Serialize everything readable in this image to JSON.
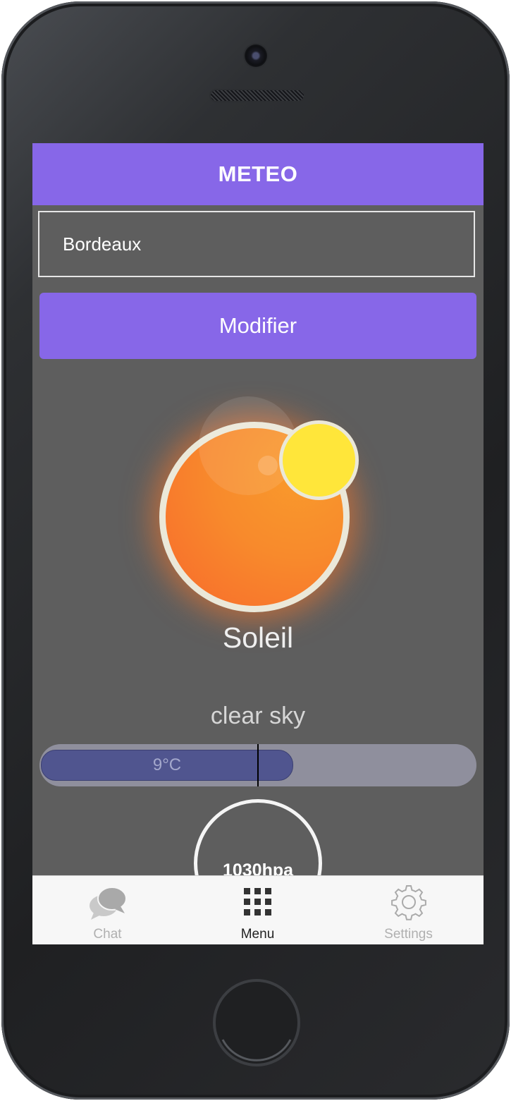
{
  "app": {
    "title": "METEO"
  },
  "search": {
    "city": "Bordeaux"
  },
  "actions": {
    "modify_label": "Modifier"
  },
  "weather": {
    "condition": "Soleil",
    "description": "clear sky",
    "temperature_label": "9°C",
    "temperature_bar_fill_fraction": 0.58,
    "pressure_label": "1030hpa"
  },
  "tabs": [
    {
      "label": "Chat",
      "icon": "chat-bubbles-icon",
      "active": false
    },
    {
      "label": "Menu",
      "icon": "grid-menu-icon",
      "active": true
    },
    {
      "label": "Settings",
      "icon": "gear-icon",
      "active": false
    }
  ],
  "colors": {
    "accent": "#8767e8",
    "screen_bg": "#5e5e5e",
    "temp_fill": "#50558f",
    "sun_orange": "#f88a2c",
    "sun_yellow": "#ffe63a"
  }
}
